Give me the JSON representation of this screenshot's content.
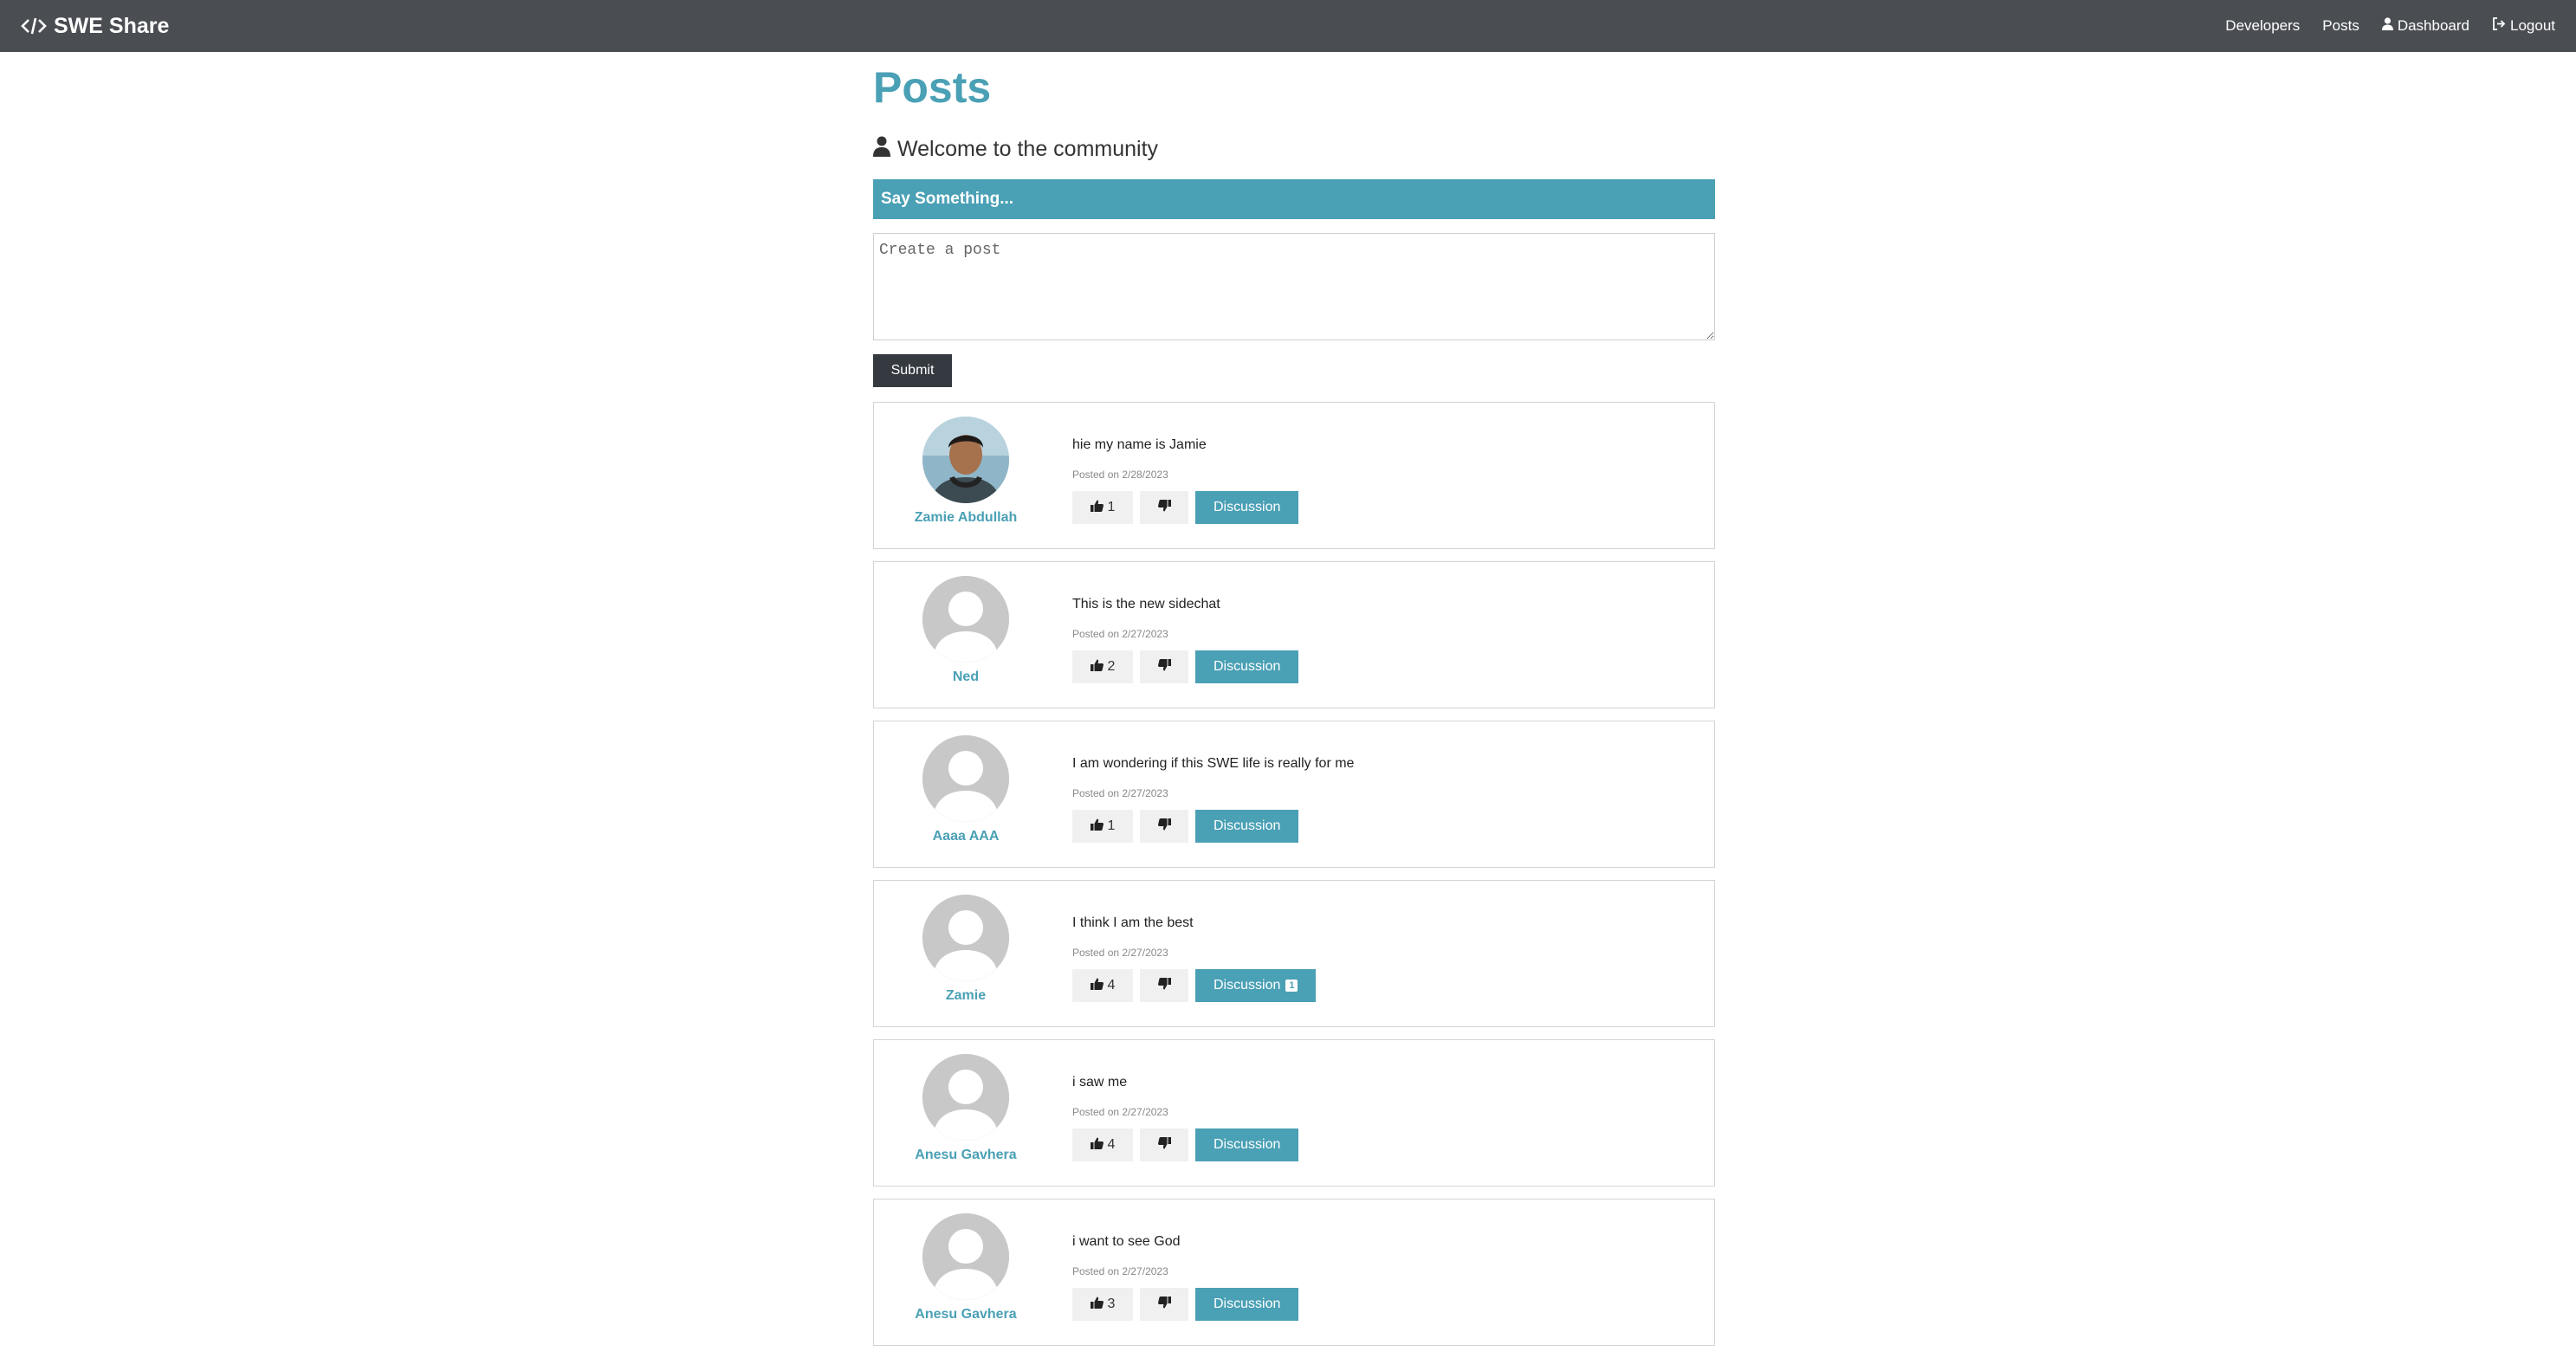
{
  "nav": {
    "brand": "SWE Share",
    "links": [
      {
        "label": "Developers",
        "icon": ""
      },
      {
        "label": "Posts",
        "icon": ""
      },
      {
        "label": "Dashboard",
        "icon": "user-icon"
      },
      {
        "label": "Logout",
        "icon": "logout-icon"
      }
    ]
  },
  "page": {
    "title": "Posts",
    "lead": "Welcome to the community"
  },
  "form": {
    "header": "Say Something...",
    "placeholder": "Create a post",
    "submit_label": "Submit"
  },
  "colors": {
    "accent": "#4aa0b5",
    "navbar": "#4a4e53",
    "dark_button": "#343a40"
  },
  "posts": [
    {
      "author": "Zamie Abdullah",
      "text": "hie my name is Jamie",
      "date": "Posted on 2/28/2023",
      "likes": "1",
      "discussion_label": "Discussion",
      "comments": "",
      "avatar": "photo"
    },
    {
      "author": "Ned",
      "text": "This is the new sidechat",
      "date": "Posted on 2/27/2023",
      "likes": "2",
      "discussion_label": "Discussion",
      "comments": "",
      "avatar": "default"
    },
    {
      "author": "Aaaa AAA",
      "text": "I am wondering if this SWE life is really for me",
      "date": "Posted on 2/27/2023",
      "likes": "1",
      "discussion_label": "Discussion",
      "comments": "",
      "avatar": "default"
    },
    {
      "author": "Zamie",
      "text": "I think I am the best",
      "date": "Posted on 2/27/2023",
      "likes": "4",
      "discussion_label": "Discussion",
      "comments": "1",
      "avatar": "default"
    },
    {
      "author": "Anesu Gavhera",
      "text": "i saw me",
      "date": "Posted on 2/27/2023",
      "likes": "4",
      "discussion_label": "Discussion",
      "comments": "",
      "avatar": "default"
    },
    {
      "author": "Anesu Gavhera",
      "text": "i want to see God",
      "date": "Posted on 2/27/2023",
      "likes": "3",
      "discussion_label": "Discussion",
      "comments": "",
      "avatar": "default"
    }
  ]
}
